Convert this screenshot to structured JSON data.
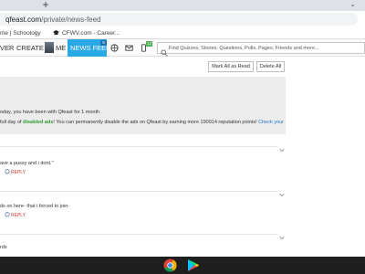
{
  "browser": {
    "new_tab_label": "+",
    "tab_end_glyph": "⌄",
    "url_host": "qfeast.com",
    "url_path": "/private/news-feed",
    "bookmarks": [
      {
        "label": "me | Schoology",
        "icon": "schoology-icon"
      },
      {
        "label": "CFWV.com - Career...",
        "icon": "graduation-cap-icon"
      }
    ]
  },
  "navbar": {
    "items": [
      "VER",
      "CREATE",
      "ME"
    ],
    "active_item": "NEWS FEED",
    "news_badge": "8",
    "phone_badge": "12",
    "search_placeholder": "Find Quizzes, Stories, Questions, Polls, Pages, Friends and more..."
  },
  "actions": {
    "mark_all_read": "Mark All as Read",
    "delete_all": "Delete All"
  },
  "notice": {
    "member_text": "oday, you have been with Qfeast for 1 month",
    "ads_prefix": "full day of ",
    "ads_bold": "disabled ads",
    "ads_middle": "! You can permanently disable the ads on Qfeast by earning more 190914 reputation points! ",
    "ads_link": "Check your"
  },
  "feed": [
    {
      "quote": "ave a pussy and i dont.\"",
      "reply_label": "REPLY"
    },
    {
      "quote": "ds on here- that i forced to join-",
      "reply_label": "REPLY"
    }
  ],
  "partial_text": "rds",
  "taskbar": {
    "apps": [
      "chrome-icon",
      "play-store-icon"
    ]
  },
  "colors": {
    "accent": "#29a8e8",
    "green": "#2e9b2e",
    "reply": "#cc3a2a",
    "link": "#1a73c8"
  }
}
